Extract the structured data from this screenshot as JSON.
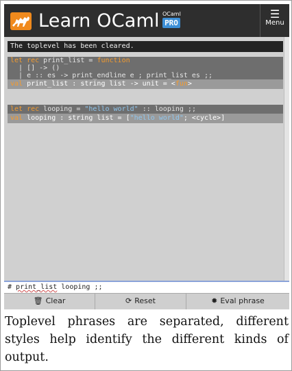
{
  "header": {
    "app_title": "Learn OCaml",
    "badge_top": "OCaml",
    "badge_pro": "PRO",
    "menu_icon": "☰",
    "menu_label": "Menu"
  },
  "console": {
    "message": "The toplevel has been cleared.",
    "block1": {
      "line1": {
        "kw1": "let rec",
        "text": " print_list = ",
        "kw2": "function"
      },
      "line2": "  | [] -> ()",
      "line3": "  | e :: es -> print_endline e ; print_list es ;;",
      "result": {
        "kw": "val",
        "text": " print_list : string list -> unit = <",
        "fun": "fun",
        "close": ">"
      }
    },
    "block2": {
      "line1": {
        "kw": "let rec",
        "text1": " looping = ",
        "str": "\"hello world\"",
        "text2": " :: looping ;;"
      },
      "result": {
        "kw": "val",
        "text1": " looping : string list = [",
        "str": "\"hello world\"",
        "text2": "; <cycle>]"
      }
    }
  },
  "input": {
    "prompt": "# ",
    "word": "print_list",
    "rest": " looping ;;"
  },
  "buttons": {
    "clear": {
      "icon": "trash-icon",
      "label": "Clear"
    },
    "reset": {
      "icon": "refresh-icon",
      "label": "Reset"
    },
    "eval": {
      "icon": "gear-icon",
      "label": "Eval phrase"
    }
  },
  "caption": "Toplevel phrases are separated, different styles help identify the different kinds of output.",
  "colors": {
    "header_bg": "#2e2e2e",
    "logo": "#f08a1d",
    "keyword": "#f49b2e",
    "string": "#8fc6ee",
    "pro_badge": "#3d8fd6"
  }
}
